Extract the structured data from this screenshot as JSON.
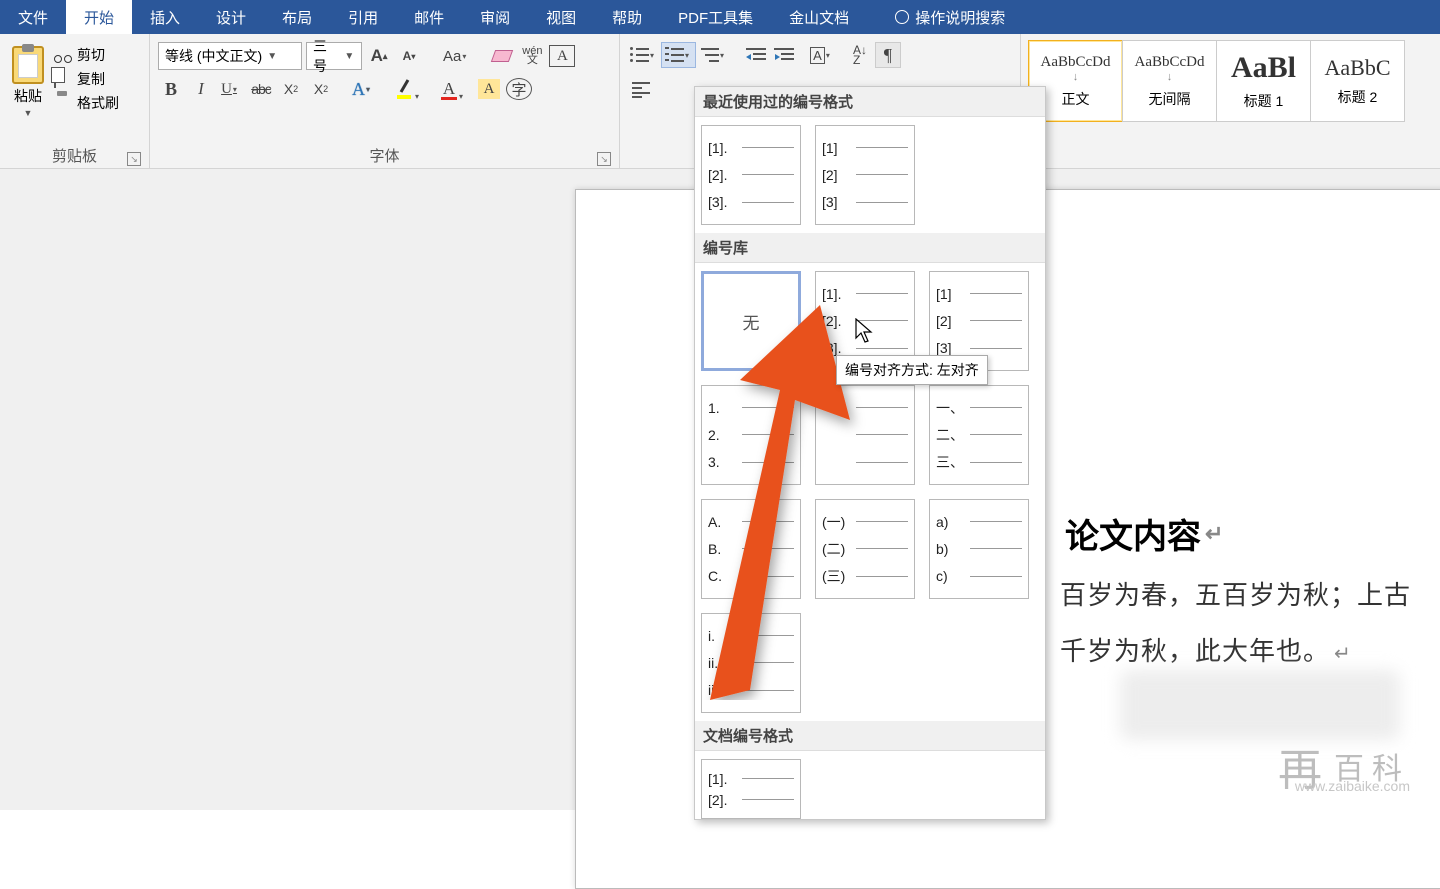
{
  "menu": {
    "tabs": [
      "文件",
      "开始",
      "插入",
      "设计",
      "布局",
      "引用",
      "邮件",
      "审阅",
      "视图",
      "帮助",
      "PDF工具集",
      "金山文档"
    ],
    "active_index": 1,
    "tellme": "操作说明搜索"
  },
  "clipboard": {
    "paste": "粘贴",
    "cut": "剪切",
    "copy": "复制",
    "painter": "格式刷",
    "group": "剪贴板"
  },
  "font": {
    "name": "等线 (中文正文)",
    "size": "三号",
    "grow": "A",
    "shrink": "A",
    "case": "Aa",
    "clear": "",
    "pinyin_top": "wén",
    "pinyin_bot": "文",
    "border_char": "A",
    "bold": "B",
    "italic": "I",
    "ul": "U",
    "strike": "abc",
    "sub": "X",
    "sub2": "2",
    "sup": "X",
    "sup2": "2",
    "effect": "A",
    "hilite": "",
    "fcolor": "A",
    "shade": "A",
    "circled": "字",
    "group": "字体"
  },
  "paragraph": {
    "sort": "A↓\nZ",
    "mark": "¶"
  },
  "styles": {
    "items": [
      {
        "preview": "AaBbCcDd",
        "name": "正文",
        "selected": true,
        "psize": "15px"
      },
      {
        "preview": "AaBbCcDd",
        "name": "无间隔",
        "selected": false,
        "psize": "15px"
      },
      {
        "preview": "AaBl",
        "name": "标题 1",
        "selected": false,
        "psize": "30px",
        "bold": true
      },
      {
        "preview": "AaBbC",
        "name": "标题 2",
        "selected": false,
        "psize": "22px"
      }
    ],
    "bullets": [
      "↓",
      "↓"
    ]
  },
  "dropdown": {
    "recent_header": "最近使用过的编号格式",
    "recent": [
      {
        "rows": [
          "[1].",
          "[2].",
          "[3]."
        ]
      },
      {
        "rows": [
          "[1]",
          "[2]",
          "[3]"
        ]
      }
    ],
    "library_header": "编号库",
    "library": [
      {
        "none": true,
        "label": "无"
      },
      {
        "rows": [
          "[1].",
          "[2].",
          "[3]."
        ]
      },
      {
        "rows": [
          "[1]",
          "[2]",
          "[3]"
        ]
      },
      {
        "rows": [
          "1.",
          "2.",
          "3."
        ]
      },
      {
        "rows": [
          "",
          "",
          ""
        ]
      },
      {
        "rows": [
          "一、",
          "二、",
          "三、"
        ]
      },
      {
        "rows": [
          "A.",
          "B.",
          "C."
        ]
      },
      {
        "rows": [
          "(一)",
          "(二)",
          "(三)"
        ]
      },
      {
        "rows": [
          "a)",
          "b)",
          "c)"
        ]
      },
      {
        "rows": [
          "i.",
          "ii.",
          "iii."
        ]
      }
    ],
    "doc_formats_header": "文档编号格式",
    "doc_formats": [
      {
        "rows": [
          "[1].",
          "[2]."
        ]
      }
    ],
    "tooltip": "编号对齐方式: 左对齐"
  },
  "document": {
    "heading": "论文内容",
    "line1": "百岁为春，五百岁为秋；上古",
    "line2": "千岁为秋，此大年也。"
  },
  "watermark": {
    "zai": "再",
    "baike": "百科",
    "url": "www.zaibaike.com"
  }
}
